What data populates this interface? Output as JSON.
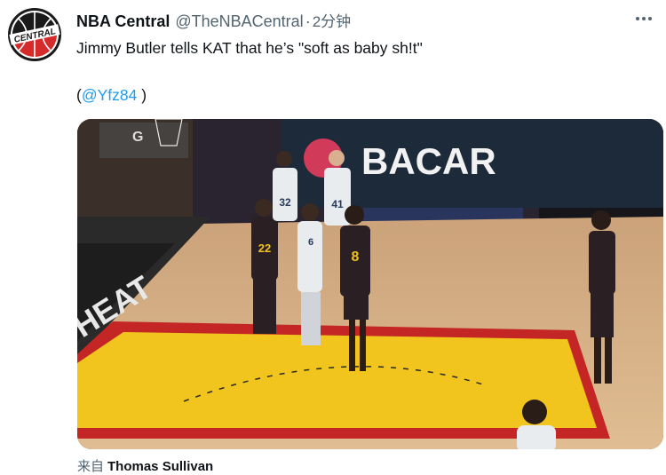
{
  "tweet": {
    "display_name": "NBA Central",
    "handle": "@TheNBACentral",
    "separator": "·",
    "timestamp": "2分钟",
    "text": "Jimmy Butler tells KAT that he’s \"soft as baby sh!t\"",
    "mention_open": "(",
    "mention": "@Yfz84",
    "mention_close": ")",
    "source_prefix": "来自",
    "source_name": "Thomas Sullivan"
  },
  "avatar": {
    "text": "CENTRAL",
    "colors": {
      "ring": "#d62b2b",
      "ball": "#1a1a1a",
      "bg": "#ffffff"
    }
  },
  "media": {
    "banner_text": "BACAR",
    "letter_g": "G",
    "floor_text": "HEAT",
    "jerseys": [
      {
        "team": "home",
        "number": "22",
        "name": ""
      },
      {
        "team": "home",
        "number": "8",
        "name": ""
      },
      {
        "team": "away",
        "number": "32",
        "name": ""
      },
      {
        "team": "away",
        "number": "41",
        "name": ""
      },
      {
        "team": "away",
        "number": "6",
        "name": ""
      }
    ],
    "colors": {
      "court": "#d8b48a",
      "paint": "#f0c020",
      "paint_border": "#c02020",
      "arena": "#1d1a22",
      "home_jersey": "#2a1f22",
      "away_jersey": "#e8ecef"
    }
  },
  "icons": {
    "more": "more-horizontal-icon"
  }
}
